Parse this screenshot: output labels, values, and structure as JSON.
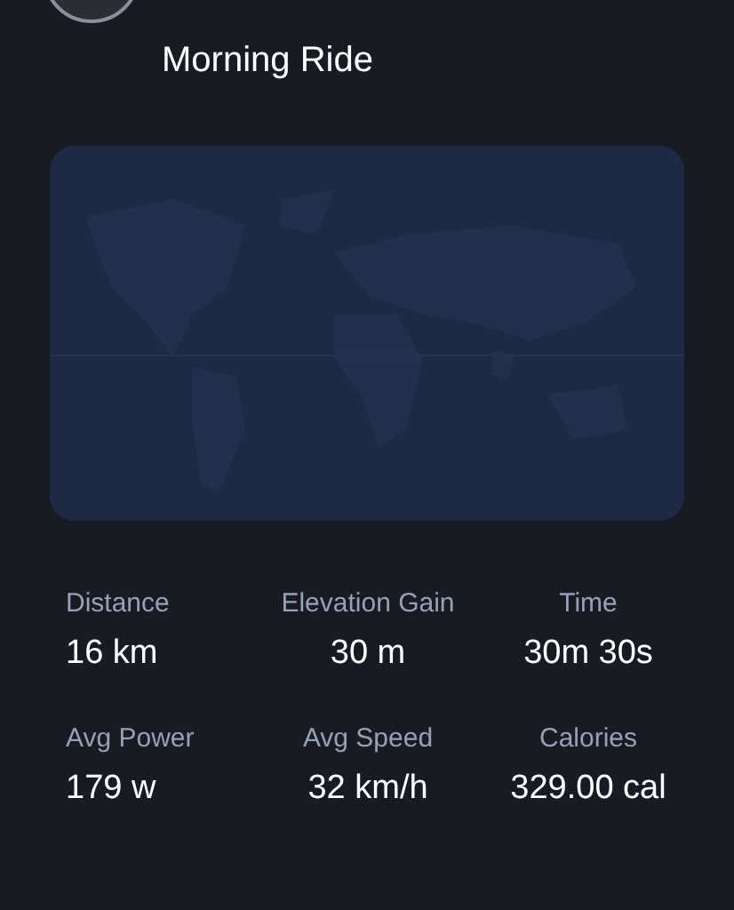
{
  "title": "Morning Ride",
  "stats": [
    {
      "label": "Distance",
      "value": "16 km"
    },
    {
      "label": "Elevation Gain",
      "value": "30 m"
    },
    {
      "label": "Time",
      "value": "30m 30s"
    },
    {
      "label": "Avg Power",
      "value": "179 w"
    },
    {
      "label": "Avg Speed",
      "value": "32 km/h"
    },
    {
      "label": "Calories",
      "value": "329.00 cal"
    }
  ]
}
